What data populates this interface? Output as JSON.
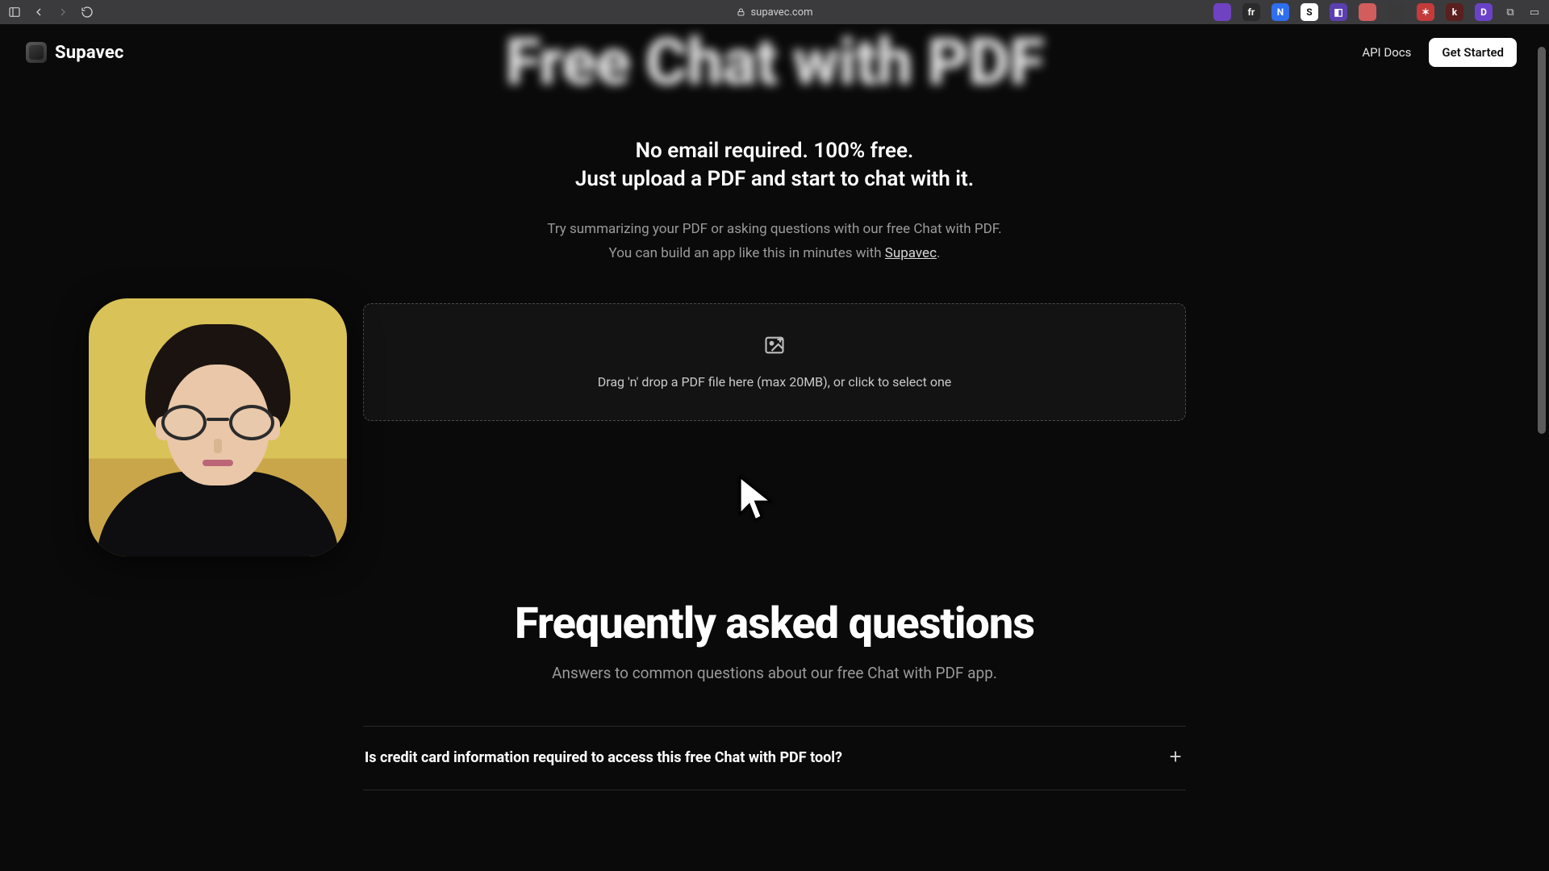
{
  "browser": {
    "url": "supavec.com",
    "extension_icons": [
      {
        "bg": "#6f42c1",
        "txt": ""
      },
      {
        "bg": "#2b2b2b",
        "txt": "fr"
      },
      {
        "bg": "#2f6fed",
        "txt": "N"
      },
      {
        "bg": "#ffffff",
        "txt": "S",
        "fg": "#111"
      },
      {
        "bg": "#5b3fb0",
        "txt": "◧"
      },
      {
        "bg": "#d35c5c",
        "txt": ""
      },
      {
        "bg": "#3a3a3a",
        "txt": ""
      },
      {
        "bg": "#c43b3b",
        "txt": "✶"
      },
      {
        "bg": "#5a1f1f",
        "txt": "k"
      },
      {
        "bg": "#6a42c8",
        "txt": "D"
      }
    ]
  },
  "header": {
    "brand": "Supavec",
    "api_docs": "API Docs",
    "get_started": "Get Started"
  },
  "hero": {
    "title_blur": "Free Chat with PDF",
    "sub_line1": "No email required. 100% free.",
    "sub_line2": "Just upload a PDF and start to chat with it.",
    "hint_line1": "Try summarizing your PDF or asking questions with our free Chat with PDF.",
    "hint_line2_a": "You can build an app like this in minutes with ",
    "hint_link": "Supavec",
    "hint_line2_b": "."
  },
  "dropzone": {
    "text": "Drag 'n' drop a PDF file here (max 20MB), or click to select one"
  },
  "faq": {
    "heading": "Frequently asked questions",
    "sub": "Answers to common questions about our free Chat with PDF app.",
    "items": [
      {
        "q": "Is credit card information required to access this free Chat with PDF tool?"
      }
    ]
  }
}
